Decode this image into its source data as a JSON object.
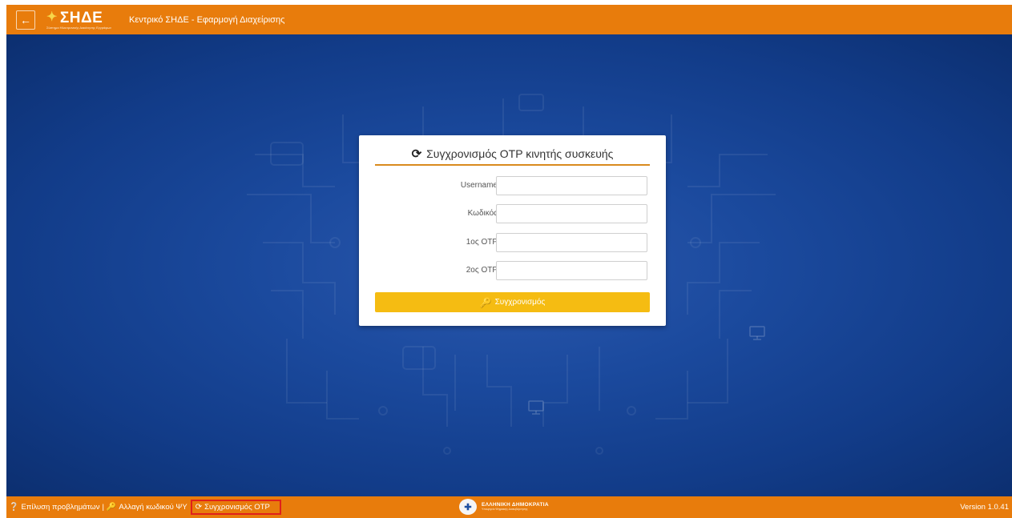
{
  "header": {
    "back_icon": "arrow-left-icon",
    "logo_text": "ΣΗΔΕ",
    "logo_subtitle": "Σύστημα Ηλεκτρονικής Διακίνησης Εγγράφων",
    "app_title": "Κεντρικό ΣΗΔΕ - Εφαρμογή Διαχείρισης"
  },
  "card": {
    "title_icon": "refresh-icon",
    "title": "Συγχρονισμός OTP κινητής συσκευής",
    "fields": [
      {
        "label": "Username",
        "value": "",
        "placeholder": ""
      },
      {
        "label": "Κωδικός",
        "value": "",
        "placeholder": ""
      },
      {
        "label": "1ος OTP",
        "value": "",
        "placeholder": ""
      },
      {
        "label": "2ος OTP",
        "value": "",
        "placeholder": ""
      }
    ],
    "submit_icon": "key-icon",
    "submit_label": "Συγχρονισμός"
  },
  "footer": {
    "links": [
      {
        "icon": "question-circle-icon",
        "label": "Επίλυση προβλημάτων"
      },
      {
        "icon": "key-icon",
        "label": "Αλλαγή κωδικού ΨΥ"
      },
      {
        "icon": "refresh-icon",
        "label": "Συγχρονισμός OTP"
      }
    ],
    "separator": "|",
    "gov_name": "ΕΛΛΗΝΙΚΗ ΔΗΜΟΚΡΑΤΙΑ",
    "gov_subtitle": "Υπουργείο Ψηφιακής Διακυβέρνησης",
    "version": "Version 1.0.41"
  },
  "colors": {
    "accent_orange": "#e87c0c",
    "button_yellow": "#f5bc12",
    "background_blue": "#1b4a9e",
    "highlight_red": "#e0201b"
  }
}
